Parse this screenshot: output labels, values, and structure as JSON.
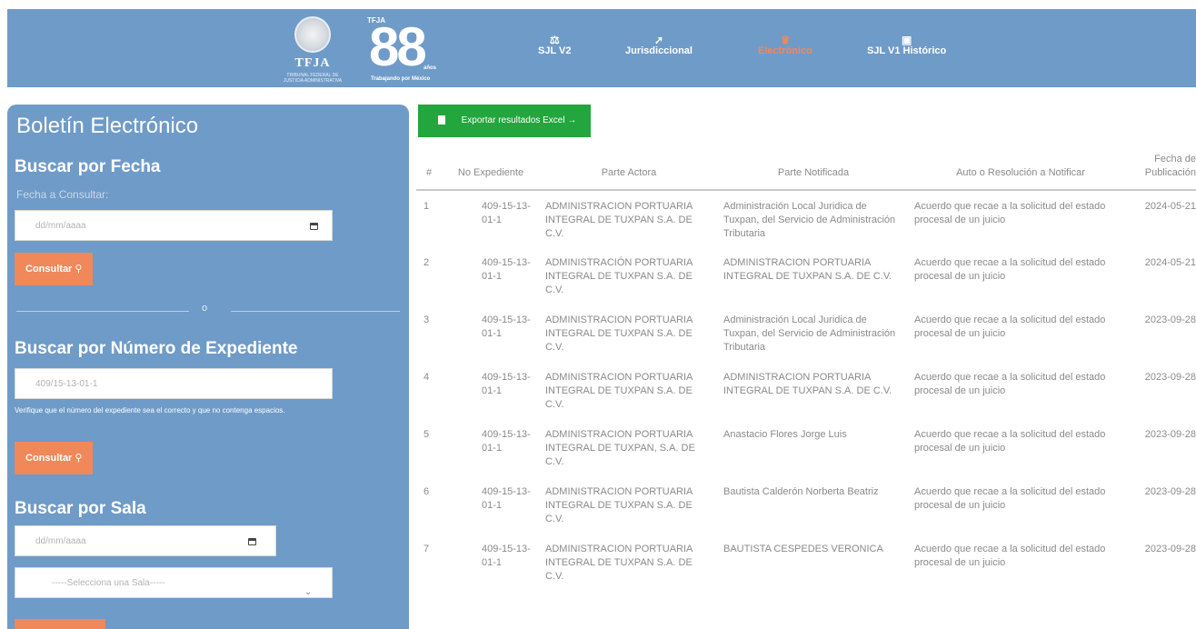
{
  "header": {
    "tfja_logo_text": "TFJA",
    "tfja_logo_sub": "TRIBUNAL FEDERAL DE JUSTICIA ADMINISTRATIVA",
    "anniv_small": "TFJA",
    "anniv_number": "88",
    "anniv_years": "años",
    "anniv_tagline": "Trabajando por México",
    "nav": [
      {
        "label": "SJL V2",
        "icon": "scales-icon"
      },
      {
        "label": "Jurisdiccional",
        "icon": "gavel-icon"
      },
      {
        "label": "Electrónico",
        "icon": "electronic-icon",
        "active": true
      },
      {
        "label": "SJL V1 Histórico",
        "icon": "archive-icon"
      }
    ],
    "accent_color": "#f0885a",
    "header_bg": "#6f9bc8"
  },
  "sidebar": {
    "title": "Boletín Electrónico",
    "by_date": {
      "heading": "Buscar por Fecha",
      "label": "Fecha a Consultar:",
      "date_placeholder": "dd/mm/aaaa",
      "button": "Consultar",
      "button_icon": "search-icon"
    },
    "divider_text": "o",
    "by_expediente": {
      "heading": "Buscar por Número de Expediente",
      "value": "409/15-13-01-1",
      "note": "Verifique que el número del expediente sea el correcto y que no contenga espacios.",
      "button": "Consultar",
      "button_icon": "search-icon"
    },
    "by_sala": {
      "heading": "Buscar por Sala",
      "date_placeholder": "dd/mm/aaaa",
      "select_value": "-----Selecciona una Sala-----"
    }
  },
  "main": {
    "export_button": "Exportar resultados Excel",
    "export_arrow": "→",
    "export_color": "#22a63d",
    "table": {
      "headers": [
        "#",
        "No Expediente",
        "Parte Actora",
        "Parte Notificada",
        "Auto o Resolución a Notificar",
        "Fecha de Publicación"
      ],
      "rows": [
        {
          "n": "1",
          "exp": "409-15-13-01-1",
          "actora": "ADMINISTRACION PORTUARIA INTEGRAL DE TUXPAN S.A. DE C.V.",
          "notificada": "Administración Local Juridica de Tuxpan, del Servicio de Administración Tributaria",
          "auto": "Acuerdo que recae a la solicitud del estado procesal de un juicio",
          "fecha": "2024-05-21"
        },
        {
          "n": "2",
          "exp": "409-15-13-01-1",
          "actora": "ADMINISTRACIÓN PORTUARIA INTEGRAL DE TUXPAN S.A. DE C.V.",
          "notificada": "ADMINISTRACION PORTUARIA INTEGRAL DE TUXPAN S.A. DE C.V.",
          "auto": "Acuerdo que recae a la solicitud del estado procesal de un juicio",
          "fecha": "2024-05-21"
        },
        {
          "n": "3",
          "exp": "409-15-13-01-1",
          "actora": "ADMINISTRACION PORTUARIA INTEGRAL DE TUXPAN S.A. DE C.V.",
          "notificada": "Administración Local Juridica de Tuxpan, del Servicio de Administración Tributaria",
          "auto": "Acuerdo que recae a la solicitud del estado procesal de un juicio",
          "fecha": "2023-09-28"
        },
        {
          "n": "4",
          "exp": "409-15-13-01-1",
          "actora": "ADMINISTRACION PORTUARIA INTEGRAL DE TUXPAN S.A. DE C.V.",
          "notificada": "ADMINISTRACION PORTUARIA INTEGRAL DE TUXPAN S.A. DE C.V.",
          "auto": "Acuerdo que recae a la solicitud del estado procesal de un juicio",
          "fecha": "2023-09-28"
        },
        {
          "n": "5",
          "exp": "409-15-13-01-1",
          "actora": "ADMINISTRACION PORTUARIA INTEGRAL DE TUXPAN, S.A. DE C.V.",
          "notificada": "Anastacio Flores Jorge Luis",
          "auto": "Acuerdo que recae a la solicitud del estado procesal de un juicio",
          "fecha": "2023-09-28"
        },
        {
          "n": "6",
          "exp": "409-15-13-01-1",
          "actora": "ADMINISTRACION PORTUARIA INTEGRAL DE TUXPAN S.A. DE C.V.",
          "notificada": "Bautista Calderón Norberta Beatriz",
          "auto": "Acuerdo que recae a la solicitud del estado procesal de un juicio",
          "fecha": "2023-09-28"
        },
        {
          "n": "7",
          "exp": "409-15-13-01-1",
          "actora": "ADMINISTRACION PORTUARIA INTEGRAL DE TUXPAN S.A. DE C.V.",
          "notificada": "BAUTISTA CESPEDES VERONICA",
          "auto": "Acuerdo que recae a la solicitud del estado procesal de un juicio",
          "fecha": "2023-09-28"
        }
      ]
    }
  }
}
